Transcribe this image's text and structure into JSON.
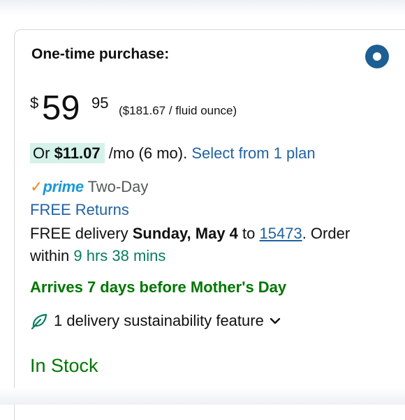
{
  "purchase_option": {
    "title": "One-time purchase:",
    "selected": true
  },
  "price": {
    "symbol": "$",
    "whole": "59",
    "fraction": "95",
    "unit_price": "($181.67 / fluid ounce)"
  },
  "installments": {
    "prefix": "Or ",
    "amount": "$11.07",
    "terms": " /mo (6 mo). ",
    "plan_link": "Select from 1 plan"
  },
  "prime": {
    "check": "✓",
    "logo": "prime",
    "label": " Two-Day"
  },
  "returns_label": "FREE Returns",
  "delivery": {
    "prefix": "FREE delivery ",
    "date": "Sunday, May 4",
    "to": " to ",
    "zip": "15473",
    "order_text": ". Order within ",
    "countdown": "9 hrs 38 mins"
  },
  "arrives_message": "Arrives 7 days before Mother's Day",
  "sustainability": {
    "label": "1 delivery sustainability feature",
    "icon": "leaf-icon"
  },
  "stock_status": "In Stock",
  "colors": {
    "link": "#2162a1",
    "green": "#007600",
    "teal": "#067d62",
    "radio": "#1d5e93",
    "highlight": "#d4f2ea",
    "prime_blue": "#1a98d5",
    "prime_check": "#f08c1a"
  }
}
